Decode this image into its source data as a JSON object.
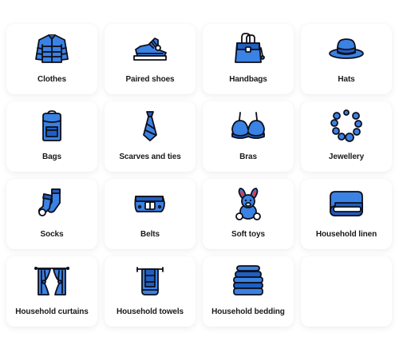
{
  "accent_color": "#3a82e4",
  "categories": [
    {
      "label": "Clothes",
      "icon": "jacket-icon"
    },
    {
      "label": "Paired shoes",
      "icon": "sneaker-icon"
    },
    {
      "label": "Handbags",
      "icon": "handbag-icon"
    },
    {
      "label": "Hats",
      "icon": "hat-icon"
    },
    {
      "label": "Bags",
      "icon": "backpack-icon"
    },
    {
      "label": "Scarves and ties",
      "icon": "tie-icon"
    },
    {
      "label": "Bras",
      "icon": "bra-icon"
    },
    {
      "label": "Jewellery",
      "icon": "necklace-icon"
    },
    {
      "label": "Socks",
      "icon": "socks-icon"
    },
    {
      "label": "Belts",
      "icon": "belt-icon"
    },
    {
      "label": "Soft toys",
      "icon": "bunny-toy-icon"
    },
    {
      "label": "Household linen",
      "icon": "folded-linen-icon"
    },
    {
      "label": "Household curtains",
      "icon": "curtains-icon"
    },
    {
      "label": "Household towels",
      "icon": "towel-rail-icon"
    },
    {
      "label": "Household bedding",
      "icon": "bedding-stack-icon"
    }
  ]
}
